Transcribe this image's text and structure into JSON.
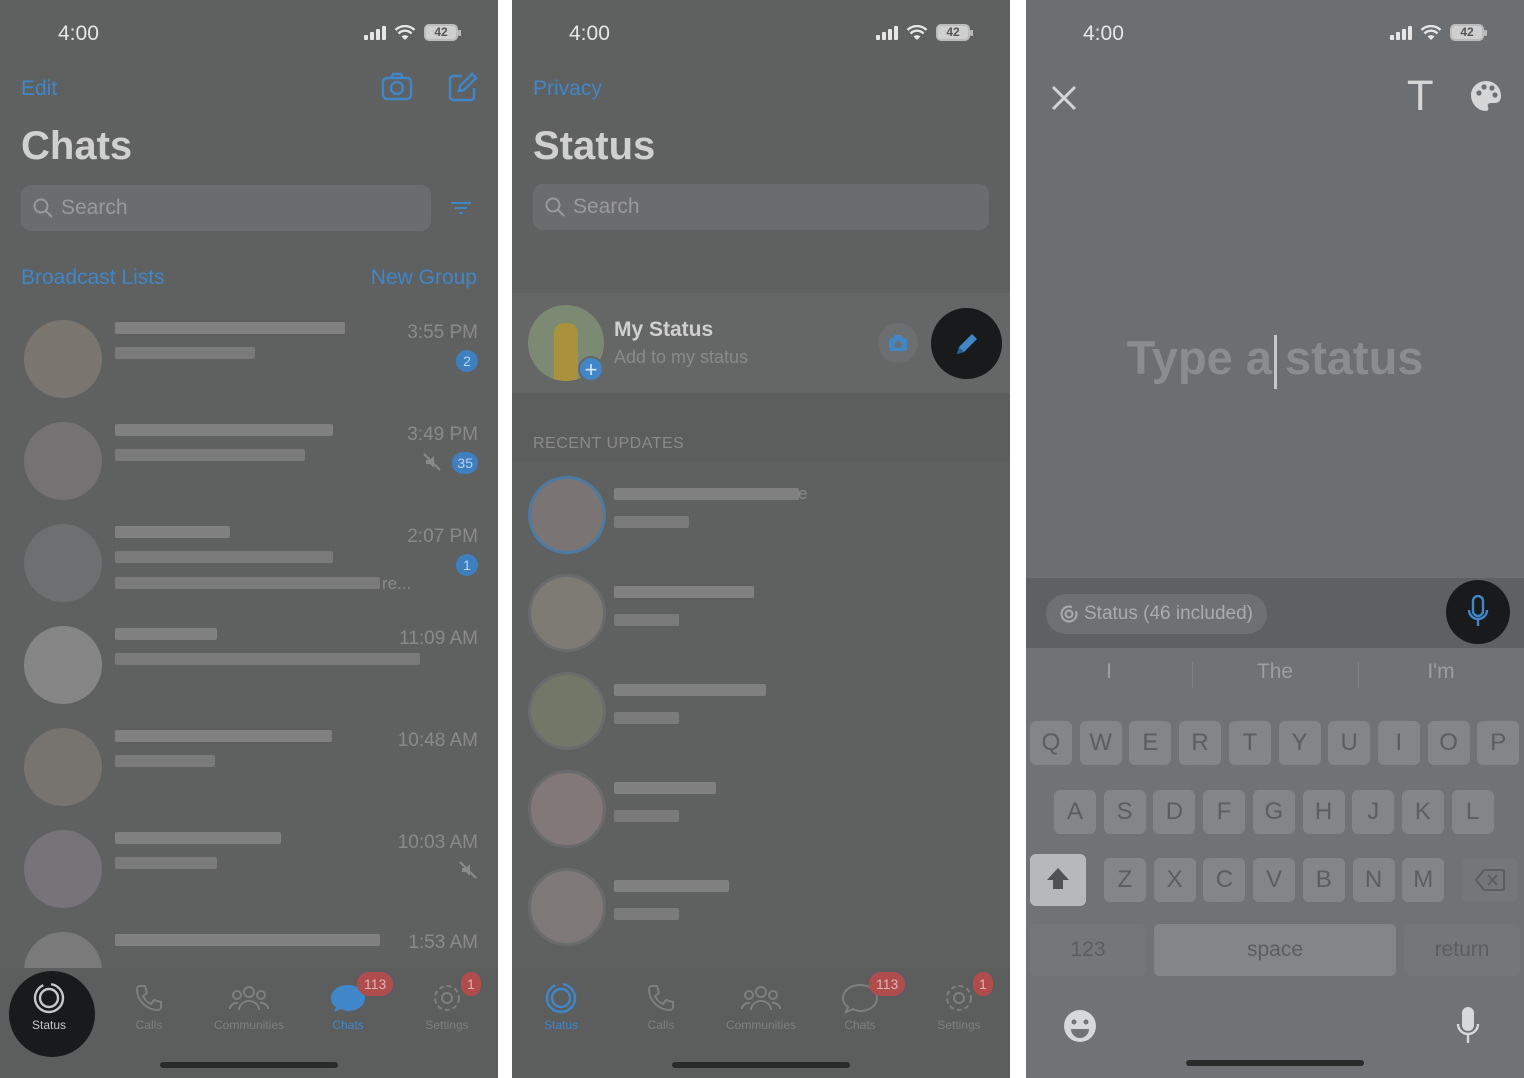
{
  "status_bar": {
    "time": "4:00",
    "battery": "42"
  },
  "chats": {
    "edit": "Edit",
    "title": "Chats",
    "search_placeholder": "Search",
    "broadcast": "Broadcast Lists",
    "new_group": "New Group",
    "rows": [
      {
        "time": "3:55 PM",
        "badge": "2"
      },
      {
        "time": "3:49 PM",
        "badge": "35",
        "muted": true
      },
      {
        "time": "2:07 PM",
        "badge": "1",
        "snippet_tail": "re..."
      },
      {
        "time": "11:09 AM"
      },
      {
        "time": "10:48 AM"
      },
      {
        "time": "10:03 AM",
        "muted": true
      },
      {
        "time": "1:53 AM"
      }
    ]
  },
  "status": {
    "privacy": "Privacy",
    "title": "Status",
    "search_placeholder": "Search",
    "my_status": "My Status",
    "add_status": "Add to my status",
    "recent_updates": "RECENT UPDATES",
    "update_tail": "e"
  },
  "tabs": {
    "status": "Status",
    "calls": "Calls",
    "communities": "Communities",
    "chats": "Chats",
    "settings": "Settings",
    "chats_badge": "113",
    "settings_badge": "1"
  },
  "compose": {
    "placeholder_a": "Type a",
    "placeholder_b": "status",
    "audience": "Status (46 included)",
    "suggestions": [
      "I",
      "The",
      "I'm"
    ],
    "row1": [
      "Q",
      "W",
      "E",
      "R",
      "T",
      "Y",
      "U",
      "I",
      "O",
      "P"
    ],
    "row2": [
      "A",
      "S",
      "D",
      "F",
      "G",
      "H",
      "J",
      "K",
      "L"
    ],
    "row3": [
      "Z",
      "X",
      "C",
      "V",
      "B",
      "N",
      "M"
    ],
    "key_123": "123",
    "key_space": "space",
    "key_return": "return",
    "text_tool": "T"
  },
  "colors": {
    "accent": "#3f87c9",
    "badge_red": "#b04c4c",
    "highlight": "#181a1b"
  }
}
